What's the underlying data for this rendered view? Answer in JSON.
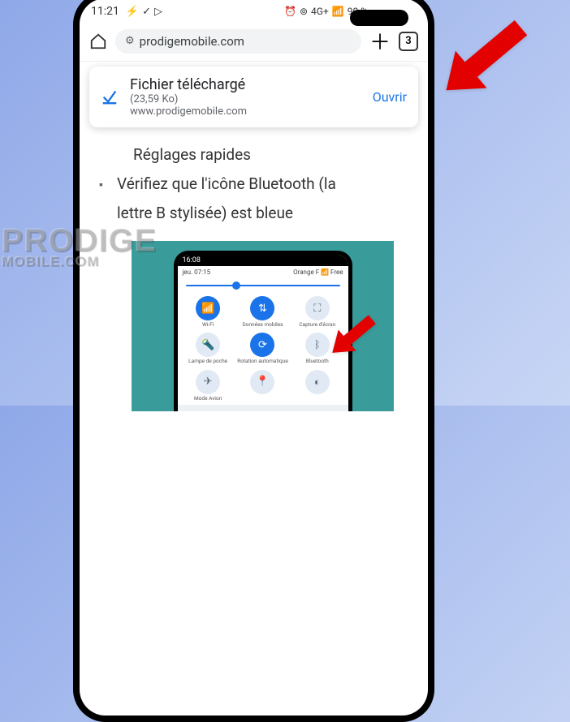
{
  "status": {
    "time": "11:21",
    "network_label": "4G+",
    "battery": "90 %"
  },
  "browser": {
    "url": "prodigemobile.com",
    "tab_count": "3"
  },
  "toast": {
    "title": "Fichier téléchargé",
    "size": "(23,59 Ko)",
    "source": "www.prodigemobile.com",
    "action": "Ouvrir"
  },
  "page": {
    "line1": "Réglages rapides",
    "line2": "Vérifiez que l'icône Bluetooth (la",
    "line3": "lettre B stylisée) est bleue"
  },
  "inner": {
    "time": "16:08",
    "date": "jeu. 07:15",
    "carrier": "Orange F",
    "carrier2": "Free",
    "tiles": [
      {
        "label": "Wi-Fi",
        "icon": "📶",
        "active": true
      },
      {
        "label": "Données mobiles",
        "icon": "⇅",
        "active": true
      },
      {
        "label": "Capture d'écran",
        "icon": "⛶",
        "active": false
      },
      {
        "label": "Lampe de poche",
        "icon": "🔦",
        "active": false
      },
      {
        "label": "Rotation automatique",
        "icon": "⟳",
        "active": true
      },
      {
        "label": "Bluetooth",
        "icon": "ᛒ",
        "active": false
      },
      {
        "label": "Mode Avion",
        "icon": "✈",
        "active": false
      },
      {
        "label": "",
        "icon": "📍",
        "active": false
      },
      {
        "label": "",
        "icon": "◐",
        "active": false
      }
    ]
  },
  "watermark": {
    "line1": "PRODIGE",
    "line2": "MOBILE.COM"
  }
}
